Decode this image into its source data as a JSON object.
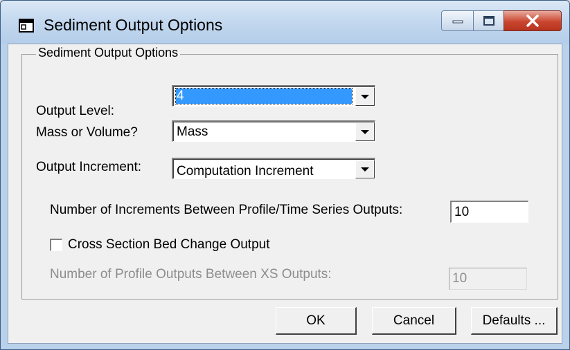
{
  "window": {
    "title": "Sediment Output Options",
    "icon": "dialog-window-icon",
    "controls": {
      "minimize": "minimize-icon",
      "maximize": "maximize-icon",
      "close": "close-icon"
    }
  },
  "group": {
    "title": "Sediment Output Options"
  },
  "output_level": {
    "label": "Output Level:",
    "value": "4"
  },
  "mass_or_volume": {
    "label": "Mass or Volume?",
    "value": "Mass"
  },
  "output_increment": {
    "label": "Output Increment:",
    "value": "Computation Increment"
  },
  "increments_between": {
    "label": "Number of Increments Between Profile/Time Series Outputs:",
    "value": "10"
  },
  "xs_bed_change": {
    "label": "Cross Section Bed Change Output",
    "checked": false
  },
  "profile_outputs_between": {
    "label": "Number of Profile Outputs Between XS Outputs:",
    "value": "10"
  },
  "buttons": {
    "ok": "OK",
    "cancel": "Cancel",
    "defaults": "Defaults ..."
  },
  "colors": {
    "titlebar": "#c6daf0",
    "close": "#c9462f",
    "selection": "#3399ff",
    "face": "#f0f0f0"
  }
}
